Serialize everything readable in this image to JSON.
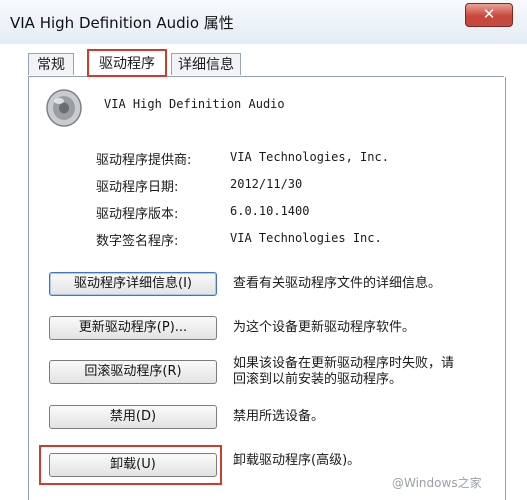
{
  "window": {
    "title": "VIA High Definition Audio 属性",
    "close_glyph": "✕"
  },
  "tabs": [
    {
      "label": "常规"
    },
    {
      "label": "驱动程序"
    },
    {
      "label": "详细信息"
    }
  ],
  "device": {
    "icon": "speaker-icon",
    "name": "VIA High Definition Audio"
  },
  "driver_info": [
    {
      "label": "驱动程序提供商:",
      "value": "VIA Technologies, Inc."
    },
    {
      "label": "驱动程序日期:",
      "value": "2012/11/30"
    },
    {
      "label": "驱动程序版本:",
      "value": "6.0.10.1400"
    },
    {
      "label": "数字签名程序:",
      "value": "VIA Technologies Inc."
    }
  ],
  "actions": [
    {
      "button": "驱动程序详细信息(I)",
      "description": "查看有关驱动程序文件的详细信息。"
    },
    {
      "button": "更新驱动程序(P)...",
      "description": "为这个设备更新驱动程序软件。"
    },
    {
      "button": "回滚驱动程序(R)",
      "description_lines": [
        "如果该设备在更新驱动程序时失败，请",
        "回滚到以前安装的驱动程序。"
      ]
    },
    {
      "button": "禁用(D)",
      "description": "禁用所选设备。"
    },
    {
      "button": "卸载(U)",
      "description": "卸载驱动程序(高级)。"
    }
  ],
  "watermark": "@Windows之家",
  "colors": {
    "highlight": "#d23a2c",
    "titlebar": "#e4ecf5"
  }
}
